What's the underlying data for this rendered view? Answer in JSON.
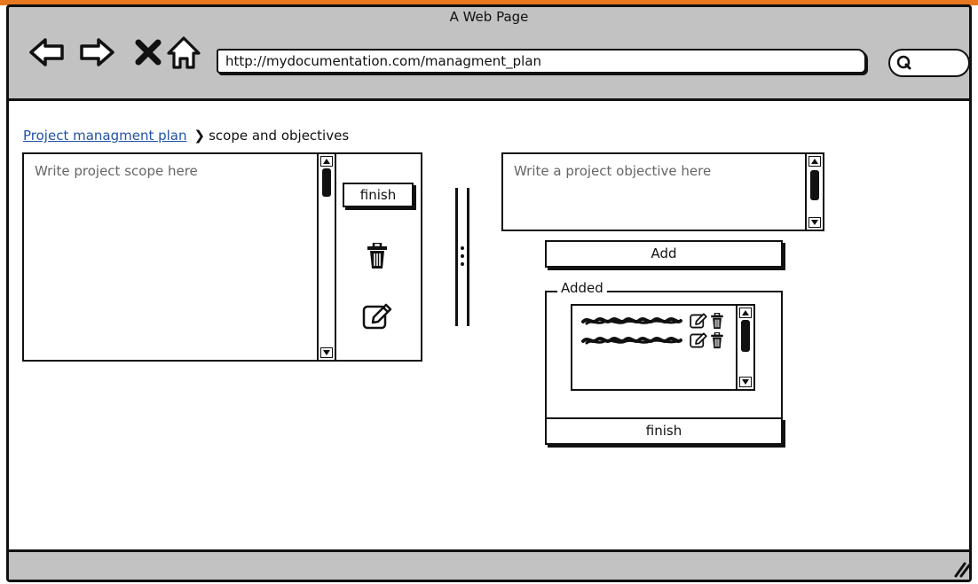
{
  "window": {
    "title": "A Web Page"
  },
  "toolbar": {
    "url": "http://mydocumentation.com/managment_plan",
    "icons": [
      "back-arrow-icon",
      "forward-arrow-icon",
      "close-icon",
      "home-icon",
      "search-icon"
    ]
  },
  "breadcrumb": {
    "link": "Project managment plan",
    "current": "scope and objectives"
  },
  "scope": {
    "placeholder": "Write project scope here",
    "finish_label": "finish"
  },
  "objective": {
    "placeholder": "Write a project objective here",
    "add_label": "Add",
    "added_legend": "Added",
    "finish_label": "finish",
    "item_count": 2
  }
}
